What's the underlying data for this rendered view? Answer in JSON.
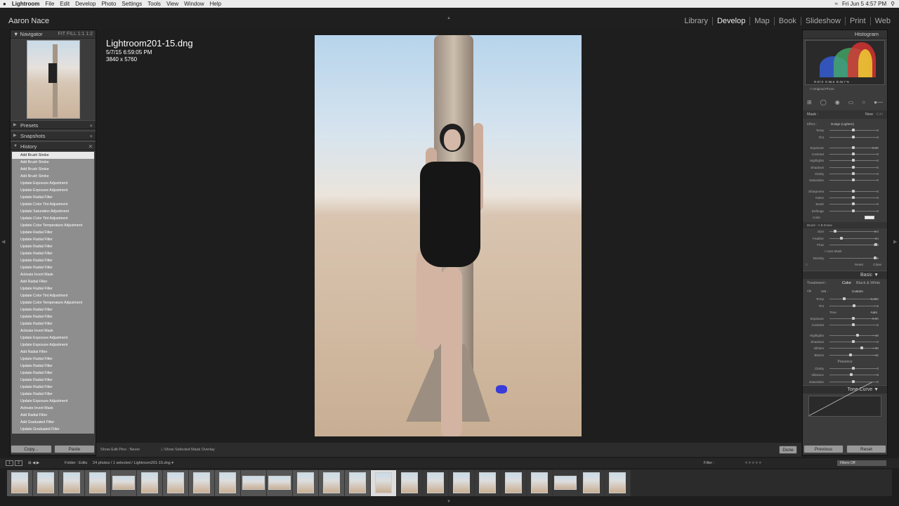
{
  "macmenu": {
    "apple": "",
    "items": [
      "Lightroom",
      "File",
      "Edit",
      "Develop",
      "Photo",
      "Settings",
      "Tools",
      "View",
      "Window",
      "Help"
    ],
    "clock": "Fri Jun 5  4:57 PM"
  },
  "identity": "Aaron Nace",
  "modules": [
    {
      "label": "Library",
      "active": false
    },
    {
      "label": "Develop",
      "active": true
    },
    {
      "label": "Map",
      "active": false
    },
    {
      "label": "Book",
      "active": false
    },
    {
      "label": "Slideshow",
      "active": false
    },
    {
      "label": "Print",
      "active": false
    },
    {
      "label": "Web",
      "active": false
    }
  ],
  "navigator": {
    "title": "Navigator",
    "zoom": "FIT   FILL   1:1   1:2"
  },
  "panels": {
    "presets": "Presets",
    "snapshots": "Snapshots",
    "history": "History"
  },
  "history": [
    "Add Brush Stroke",
    "Add Brush Stroke",
    "Add Brush Stroke",
    "Add Brush Stroke",
    "Update Exposure Adjustment",
    "Update Exposure Adjustment",
    "Update Radial Filter",
    "Update Color Tint Adjustment",
    "Update Saturation Adjustment",
    "Update Color Tint Adjustment",
    "Update Color Temperature Adjustment",
    "Update Radial Filter",
    "Update Radial Filter",
    "Update Radial Filter",
    "Update Radial Filter",
    "Update Radial Filter",
    "Update Radial Filter",
    "Activate Invert Mask",
    "Add Radial Filter",
    "Update Radial Filter",
    "Update Color Tint Adjustment",
    "Update Color Temperature Adjustment",
    "Update Radial Filter",
    "Update Radial Filter",
    "Update Radial Filter",
    "Activate Invert Mask",
    "Update Exposure Adjustment",
    "Update Exposure Adjustment",
    "Add Radial Filter",
    "Update Radial Filter",
    "Update Radial Filter",
    "Update Radial Filter",
    "Update Radial Filter",
    "Update Radial Filter",
    "Update Radial Filter",
    "Update Exposure Adjustment",
    "Activate Invert Mask",
    "Add Radial Filter",
    "Add Graduated Filter",
    "Update Graduated Filter",
    "Update Exposure Adjustment"
  ],
  "copy_label": "Copy...",
  "paste_label": "Paste",
  "file": {
    "name": "Lightroom201-15.dng",
    "date": "5/7/15 6:59:05 PM",
    "dims": "3840 x 5760"
  },
  "toolbar": {
    "pins_label": "Show Edit Pins :",
    "pins_value": "Never",
    "overlay_label": "Show Selected Mask Overlay",
    "done": "Done"
  },
  "histogram": {
    "title": "Histogram",
    "r": "R  67.0",
    "g": "G  56.6",
    "b": "B  46.7  %",
    "original": "Original Photo"
  },
  "mask": {
    "label": "Mask :",
    "new": "New",
    "edit": "Edit"
  },
  "brush": {
    "effect_label": "Effect :",
    "effect_value": "Dodge (Lighten)",
    "sliders": [
      {
        "label": "Temp",
        "value": "0"
      },
      {
        "label": "Tint",
        "value": "0"
      },
      {
        "label": "Exposure",
        "value": "0.25"
      },
      {
        "label": "Contrast",
        "value": "0"
      },
      {
        "label": "Highlights",
        "value": "0"
      },
      {
        "label": "Shadows",
        "value": "0"
      },
      {
        "label": "Clarity",
        "value": "0"
      },
      {
        "label": "Saturation",
        "value": "0"
      },
      {
        "label": "Sharpness",
        "value": "0"
      },
      {
        "label": "Noise",
        "value": "0"
      },
      {
        "label": "Moiré",
        "value": "0"
      },
      {
        "label": "Defringe",
        "value": "0"
      }
    ],
    "color": "Color",
    "brushrow": "Brush :     A     B     Erase",
    "size": {
      "label": "Size",
      "value": "6.0"
    },
    "feather": {
      "label": "Feather",
      "value": "24"
    },
    "flow": {
      "label": "Flow",
      "value": "100"
    },
    "automask": "Auto Mask",
    "density": {
      "label": "Density",
      "value": "99"
    },
    "reset": "Reset",
    "close": "Close"
  },
  "basic": {
    "title": "Basic",
    "treatment": "Treatment :",
    "color": "Color",
    "bw": "Black & White",
    "wb": "WB :",
    "wb_value": "Custom",
    "temp": {
      "label": "Temp",
      "value": "6,350"
    },
    "tint": {
      "label": "Tint",
      "value": "+ 6"
    },
    "tone": "Tone",
    "auto": "Auto",
    "tones": [
      {
        "label": "Exposure",
        "value": "0.00"
      },
      {
        "label": "Contrast",
        "value": "0"
      },
      {
        "label": "Highlights",
        "value": "+ 19"
      },
      {
        "label": "Shadows",
        "value": "0"
      },
      {
        "label": "Whites",
        "value": "+ 38"
      },
      {
        "label": "Blacks",
        "value": "− 12"
      }
    ],
    "presence": "Presence",
    "pres": [
      {
        "label": "Clarity",
        "value": "0"
      },
      {
        "label": "Vibrance",
        "value": "− 8"
      },
      {
        "label": "Saturation",
        "value": "0"
      }
    ]
  },
  "tonecurve": "Tone Curve",
  "previous": "Previous",
  "reset": "Reset",
  "filmbar": {
    "source": "Folder : Edits",
    "count": "24 photos / 1 selected / Lightroom201-15.dng",
    "filter": "Filter :",
    "filters_off": "Filters Off"
  }
}
